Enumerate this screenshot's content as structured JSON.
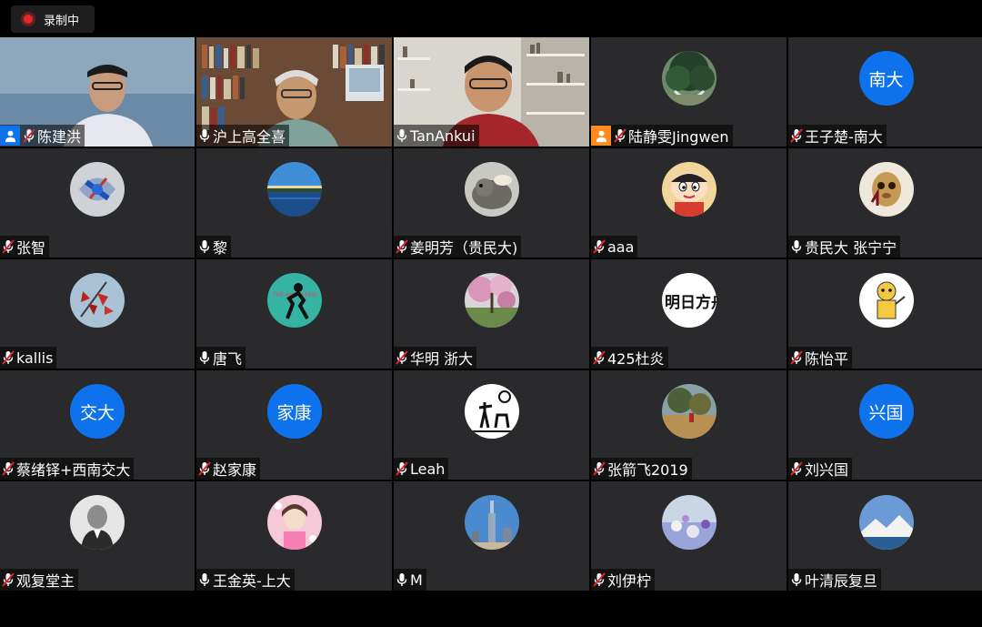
{
  "recording": {
    "label": "录制中"
  },
  "tiles": [
    {
      "name": "陈建洪",
      "type": "video",
      "muted": true,
      "host_badge": true,
      "badge_color": "#0e72ed"
    },
    {
      "name": "沪上高全喜",
      "type": "video",
      "muted": false
    },
    {
      "name": "TanAnkui",
      "type": "video",
      "muted": false,
      "speaking": true
    },
    {
      "name": "陆静雯Jingwen",
      "type": "avatar",
      "muted": true,
      "host_badge": true,
      "badge_color": "#ff8a1f",
      "avatar": "tree-photo"
    },
    {
      "name": "王子楚-南大",
      "type": "initials",
      "initials": "南大",
      "muted": true
    },
    {
      "name": "张智",
      "type": "avatar",
      "muted": true,
      "avatar": "abstract-blue"
    },
    {
      "name": "黎",
      "type": "avatar",
      "muted": false,
      "avatar": "lake-landscape"
    },
    {
      "name": "姜明芳（贵民大)",
      "type": "avatar",
      "muted": true,
      "avatar": "cat-photo"
    },
    {
      "name": "aaa",
      "type": "avatar",
      "muted": true,
      "avatar": "cartoon-boy"
    },
    {
      "name": "贵民大 张宁宁",
      "type": "avatar",
      "muted": false,
      "avatar": "animal-wine"
    },
    {
      "name": "kallis",
      "type": "avatar",
      "muted": true,
      "avatar": "red-leaves"
    },
    {
      "name": "唐飞",
      "type": "avatar",
      "muted": false,
      "avatar": "silhouette-teal"
    },
    {
      "name": "华明 浙大",
      "type": "avatar",
      "muted": true,
      "avatar": "cherry-blossom"
    },
    {
      "name": "425杜炎",
      "type": "avatar",
      "muted": true,
      "avatar": "calligraphy"
    },
    {
      "name": "陈怡平",
      "type": "avatar",
      "muted": true,
      "avatar": "cartoon-yellow"
    },
    {
      "name": "蔡绪铎+西南交大",
      "type": "initials",
      "initials": "交大",
      "muted": true
    },
    {
      "name": "赵家康",
      "type": "initials",
      "initials": "家康",
      "muted": true
    },
    {
      "name": "Leah",
      "type": "avatar",
      "muted": true,
      "avatar": "don-quixote"
    },
    {
      "name": "张箭飞2019",
      "type": "avatar",
      "muted": true,
      "avatar": "autumn-field"
    },
    {
      "name": "刘兴国",
      "type": "initials",
      "initials": "兴国",
      "muted": true
    },
    {
      "name": "观复堂主",
      "type": "avatar",
      "muted": true,
      "avatar": "portrait-bw"
    },
    {
      "name": "王金英-上大",
      "type": "avatar",
      "muted": false,
      "avatar": "girl-pink"
    },
    {
      "name": "M",
      "type": "avatar",
      "muted": false,
      "avatar": "city-tower"
    },
    {
      "name": "刘伊柠",
      "type": "avatar",
      "muted": true,
      "avatar": "flowers-field"
    },
    {
      "name": "叶清辰复旦",
      "type": "avatar",
      "muted": false,
      "avatar": "mountain-sky"
    }
  ]
}
